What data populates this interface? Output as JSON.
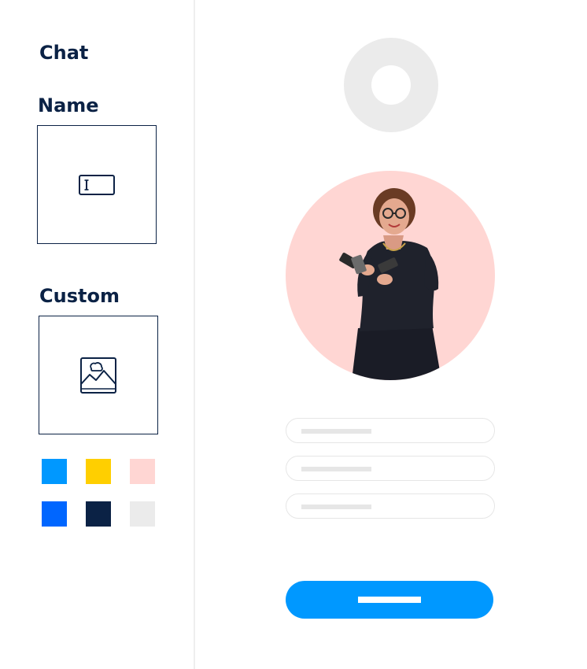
{
  "sidebar": {
    "chat_heading": "Chat",
    "name_heading": "Name",
    "custom_heading": "Custom",
    "name_option_icon": "text-field-icon",
    "custom_option_icon": "image-icon",
    "swatches": [
      {
        "color": "#0098ff"
      },
      {
        "color": "#ffcf00"
      },
      {
        "color": "#ffd6d3"
      },
      {
        "color": "#0066ff"
      },
      {
        "color": "#0b2245"
      },
      {
        "color": "#ebebeb"
      }
    ]
  },
  "preview": {
    "avatar_placeholder_icon": "avatar-ring-icon",
    "photo_background_color": "#ffd6d3",
    "field_border_color": "#e6e6e6",
    "button_color": "#0098ff"
  }
}
